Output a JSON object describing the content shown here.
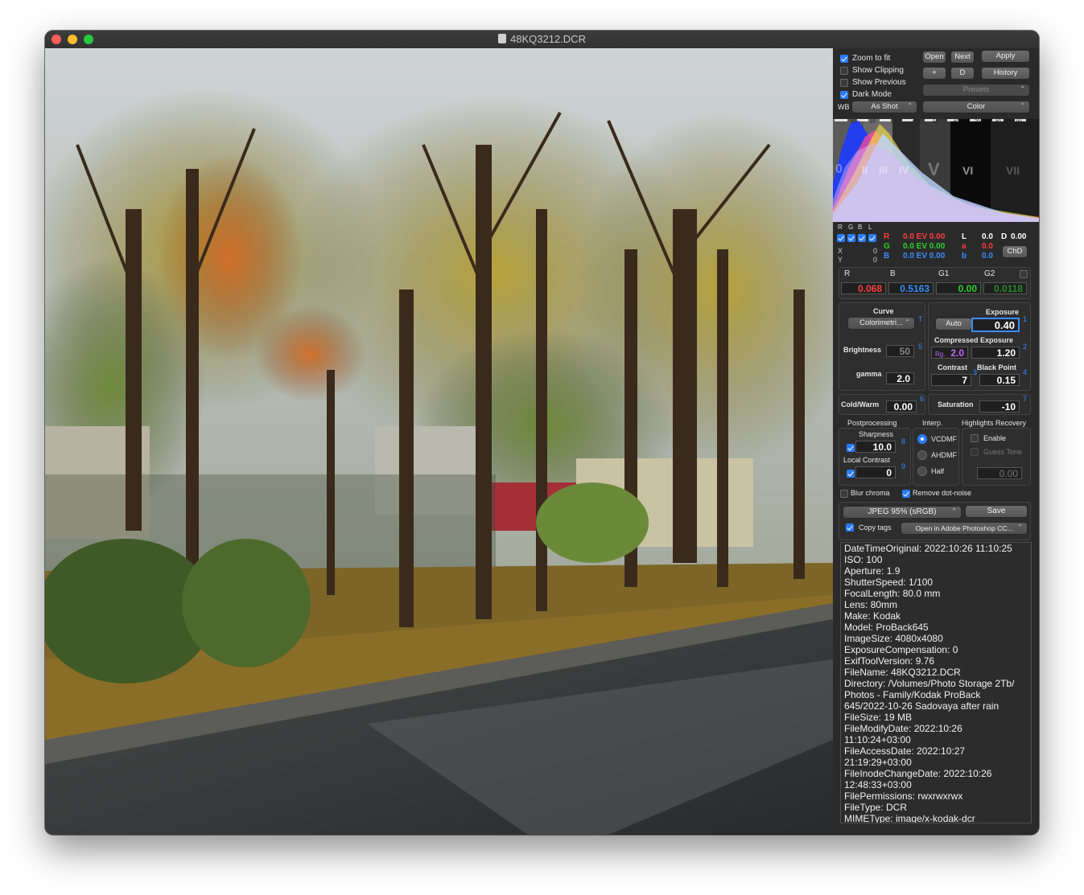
{
  "window": {
    "title": "48KQ3212.DCR"
  },
  "colors": {
    "accent": "#2b7bff",
    "red": "#ff3b3b",
    "green": "#2bd12b",
    "blue": "#3a8cff",
    "purple": "#c06bff"
  },
  "toolbar": {
    "zoom_to_fit": "Zoom to fit",
    "show_clipping": "Show Clipping",
    "show_previous": "Show Previous",
    "dark_mode": "Dark Mode",
    "open": "Open",
    "next": "Next",
    "apply": "Apply",
    "plus": "+",
    "d": "D",
    "history": "History",
    "presets": "Presets",
    "wb_label": "WB",
    "wb_value": "As Shot",
    "color_mode": "Color",
    "zoom_checked": true,
    "dark_checked": true
  },
  "histogram": {
    "scale": [
      "10",
      "20",
      "30",
      "40",
      "50",
      "60",
      "70",
      "80",
      "90"
    ],
    "zones": [
      "0",
      "II",
      "III",
      "IV",
      "V",
      "VI",
      "VII"
    ]
  },
  "channels": {
    "headers": [
      "R",
      "G",
      "B",
      "L"
    ],
    "x_label": "X",
    "x_value": "0",
    "y_label": "Y",
    "y_value": "0",
    "r_label": "R",
    "r_value": "0.0 EV 0.00",
    "g_label": "G",
    "g_value": "0.0 EV 0.00",
    "b_label": "B",
    "b_value": "0.0 EV 0.00",
    "l_label": "L",
    "l_value": "0.0",
    "d_label": "D",
    "d_value": "0.00",
    "a_label": "a",
    "a_value": "0.0",
    "lab_b_label": "b",
    "lab_b_value": "0.0",
    "chd": "ChD"
  },
  "wb_coeffs": {
    "r_label": "R",
    "b_label": "B",
    "g1_label": "G1",
    "g2_label": "G2",
    "r": "0.068",
    "b": "0.5163",
    "g1": "0.00",
    "g2": "0.0118"
  },
  "curve": {
    "title": "Curve",
    "preset": "Colorimetri...",
    "brightness_label": "Brightness",
    "brightness": "50",
    "gamma_label": "gamma",
    "gamma": "2.0",
    "n_t": "T",
    "n_5": "5"
  },
  "exposure": {
    "title": "Exposure",
    "auto": "Auto",
    "value": "0.40",
    "compressed_title": "Compressed Exposure",
    "rg": "Rg.",
    "rg_value": "2.0",
    "compressed_value": "1.20",
    "contrast_label": "Contrast",
    "contrast": "7",
    "blackpoint_label": "Black Point",
    "blackpoint": "0.15",
    "n_1": "1",
    "n_2": "2",
    "n_3": "3",
    "n_4": "4"
  },
  "tone": {
    "coldwarm_label": "Cold/Warm",
    "coldwarm": "0.00",
    "saturation_label": "Saturation",
    "saturation": "-10",
    "n_6": "6",
    "n_7": "7"
  },
  "post": {
    "title": "Postprocessing",
    "sharpness_label": "Sharpness",
    "sharpness": "10.0",
    "local_contrast_label": "Local Contrast",
    "local_contrast": "0",
    "n_8": "8",
    "n_9": "9"
  },
  "interp": {
    "title": "Interp.",
    "options": [
      "VCDMF",
      "AHDMF",
      "Half"
    ]
  },
  "highlights": {
    "title": "Highlights Recovery",
    "enable": "Enable",
    "guess_tone": "Guess Tone",
    "value": "0.00"
  },
  "noise": {
    "blur_chroma": "Blur chroma",
    "remove_dot_noise": "Remove dot-noise"
  },
  "output": {
    "format": "JPEG 95% (sRGB)",
    "save": "Save",
    "copy_tags": "Copy tags",
    "open_in": "Open in Adobe Photoshop CC..."
  },
  "exif": [
    "DateTimeOriginal: 2022:10:26 11:10:25",
    "ISO: 100",
    "Aperture: 1.9",
    "ShutterSpeed: 1/100",
    "FocalLength: 80.0 mm",
    "Lens: 80mm",
    "Make: Kodak",
    "Model: ProBack645",
    "ImageSize: 4080x4080",
    "ExposureCompensation: 0",
    "ExifToolVersion: 9.76",
    "FileName: 48KQ3212.DCR",
    "Directory: /Volumes/Photo Storage 2Tb/",
    "Photos - Family/Kodak ProBack",
    "645/2022-10-26 Sadovaya after rain",
    "FileSize: 19 MB",
    "FileModifyDate: 2022:10:26",
    "11:10:24+03:00",
    "FileAccessDate: 2022:10:27",
    "21:19:29+03:00",
    "FileInodeChangeDate: 2022:10:26",
    "12:48:33+03:00",
    "FilePermissions: rwxrwxrwx",
    "FileType: DCR",
    "MIMEType: image/x-kodak-dcr"
  ]
}
